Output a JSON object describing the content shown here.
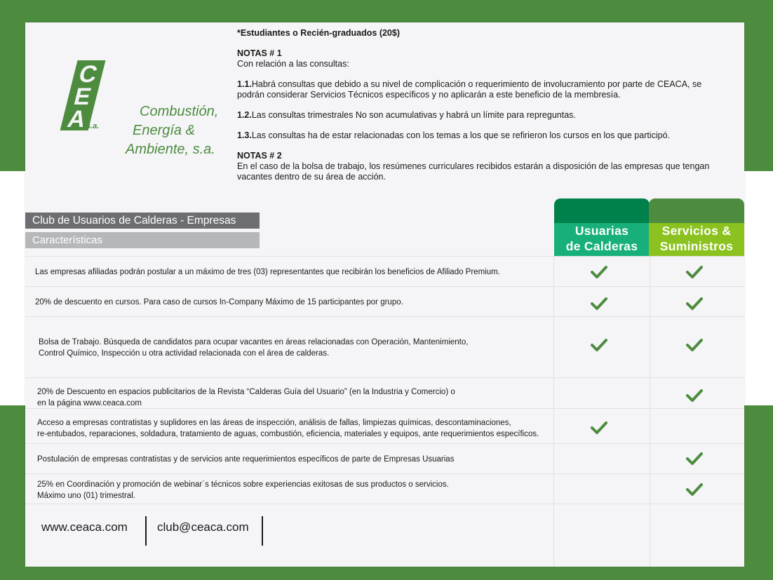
{
  "logo": {
    "letters": "CEA",
    "suffix": "s.a.",
    "lines": [
      "Combustión,",
      "Energía &",
      "Ambiente, s.a."
    ]
  },
  "notes": {
    "students": "*Estudiantes o Recién-graduados (20$)",
    "n1_title": "NOTAS # 1",
    "n1_intro": "Con relación a las consultas:",
    "n1_1_num": "1.1.",
    "n1_1_text": "Habrá consultas que debido a su nivel de complicación o requerimiento de involucramiento por parte de CEACA, se podrán considerar Servicios Técnicos específicos y no aplicarán a este beneficio de la membresía.",
    "n1_2_num": "1.2.",
    "n1_2_text": "Las consultas trimestrales No son acumulativas y habrá un límite para repreguntas.",
    "n1_3_num": "1.3.",
    "n1_3_text": "Las consultas ha de estar relacionadas con los temas a los que se refirieron los cursos en los que participó.",
    "n2_title": "NOTAS # 2",
    "n2_text": "En el caso de la bolsa de trabajo, los resúmenes curriculares recibidos estarán a disposición de las empresas que tengan vacantes dentro de su área de acción."
  },
  "table": {
    "title": "Club de Usuarios de Calderas - Empresas",
    "subtitle": "Características",
    "columns": [
      {
        "line1": "Usuarias",
        "line2": "de Calderas",
        "cap_color": "#00804a",
        "color": "#17b07a"
      },
      {
        "line1": "Servicios &",
        "line2": "Suministros",
        "cap_color": "#4d8c3f",
        "color": "#8cc21f"
      }
    ],
    "rows": [
      {
        "lines": [
          "Las empresas afiliadas podrán postular a un máximo de tres (03) representantes que recibirán los beneficios de Afiliado Premium."
        ],
        "usuarias": true,
        "servicios": true
      },
      {
        "lines": [
          "20% de descuento en cursos. Para caso de cursos In-Company Máximo de 15 participantes por grupo."
        ],
        "usuarias": true,
        "servicios": true
      },
      {
        "lines": [
          "Bolsa de Trabajo.  Búsqueda de candidatos para ocupar vacantes en áreas relacionadas con Operación, Mantenimiento,",
          "Control Químico, Inspección u otra actividad relacionada con el área de calderas."
        ],
        "usuarias": true,
        "servicios": true
      },
      {
        "lines": [
          "20% de Descuento en espacios publicitarios de la Revista “Calderas Guía del Usuario” (en la Industria y Comercio) o",
          "en la página www.ceaca.com"
        ],
        "usuarias": false,
        "servicios": true
      },
      {
        "lines": [
          "Acceso a empresas contratistas y suplidores en las áreas de inspección, análisis de fallas, limpiezas químicas, descontaminaciones,",
          "re-entubados, reparaciones, soldadura, tratamiento de aguas, combustión, eficiencia, materiales y equipos, ante requerimientos específicos."
        ],
        "usuarias": true,
        "servicios": false
      },
      {
        "lines": [
          "Postulación de empresas contratistas y de servicios ante requerimientos específicos de parte de Empresas Usuarias"
        ],
        "usuarias": false,
        "servicios": true
      },
      {
        "lines": [
          "25% en Coordinación y promoción de webinar´s  técnicos sobre experiencias exitosas de sus productos o servicios.",
          "Máximo uno (01) trimestral."
        ],
        "usuarias": false,
        "servicios": true
      }
    ]
  },
  "footer": {
    "website": "www.ceaca.com",
    "email": "club@ceaca.com"
  },
  "colors": {
    "brand_green": "#4d8c3f",
    "check_green": "#4d8c3f"
  },
  "icons": {
    "check": "check-icon"
  }
}
